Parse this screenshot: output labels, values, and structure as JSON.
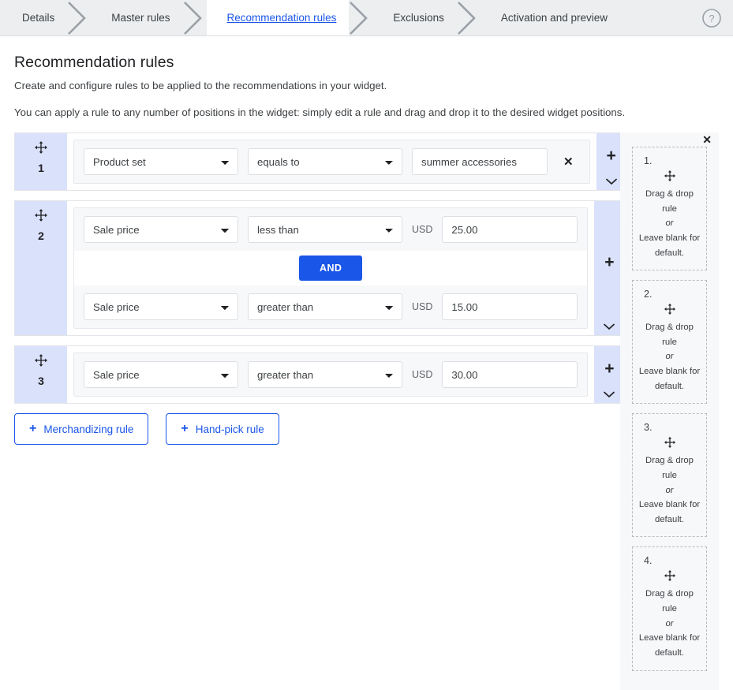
{
  "stepper": {
    "steps": [
      {
        "label": "Details",
        "active": false
      },
      {
        "label": "Master rules",
        "active": false
      },
      {
        "label": "Recommendation rules",
        "active": true
      },
      {
        "label": "Exclusions",
        "active": false
      },
      {
        "label": "Activation and preview",
        "active": false
      }
    ],
    "help_icon": "help-circle-icon"
  },
  "page": {
    "title": "Recommendation rules",
    "subtitle": "Create and configure rules to be applied to the recommendations in your widget.",
    "hint": "You can apply a rule to any number of positions in the widget: simply edit a rule and drag and drop it to the desired widget positions."
  },
  "icons": {
    "drag": "move-arrows-icon",
    "plus": "+",
    "close": "✕",
    "chevron_down": "chevron-down-icon"
  },
  "rules": [
    {
      "number": "1",
      "conditions": [
        {
          "field": "Product set",
          "operator": "equals to",
          "currency": "",
          "value": "summer accessories",
          "has_remove": true,
          "remove_label": "✕"
        }
      ],
      "connector": ""
    },
    {
      "number": "2",
      "conditions": [
        {
          "field": "Sale price",
          "operator": "less than",
          "currency": "USD",
          "value": "25.00",
          "has_remove": false,
          "remove_label": ""
        },
        {
          "field": "Sale price",
          "operator": "greater than",
          "currency": "USD",
          "value": "15.00",
          "has_remove": false,
          "remove_label": ""
        }
      ],
      "connector": "AND"
    },
    {
      "number": "3",
      "conditions": [
        {
          "field": "Sale price",
          "operator": "greater than",
          "currency": "USD",
          "value": "30.00",
          "has_remove": false,
          "remove_label": ""
        }
      ],
      "connector": ""
    }
  ],
  "field_options": [
    "Product set",
    "Sale price"
  ],
  "operator_options": [
    "equals to",
    "less than",
    "greater than"
  ],
  "buttons": {
    "merchandizing_rule": "Merchandizing rule",
    "hand_pick_rule": "Hand-pick rule",
    "plus": "+"
  },
  "sidebar": {
    "close_label": "✕",
    "slots": [
      {
        "number": "1.",
        "line1": "Drag & drop rule",
        "or": "or",
        "line2": "Leave blank for default."
      },
      {
        "number": "2.",
        "line1": "Drag & drop rule",
        "or": "or",
        "line2": "Leave blank for default."
      },
      {
        "number": "3.",
        "line1": "Drag & drop rule",
        "or": "or",
        "line2": "Leave blank for default."
      },
      {
        "number": "4.",
        "line1": "Drag & drop rule",
        "or": "or",
        "line2": "Leave blank for default."
      }
    ]
  },
  "colors": {
    "accent": "#1a56e8",
    "handle_bg": "#d9e1fb",
    "stepper_bg": "#eceef0"
  }
}
